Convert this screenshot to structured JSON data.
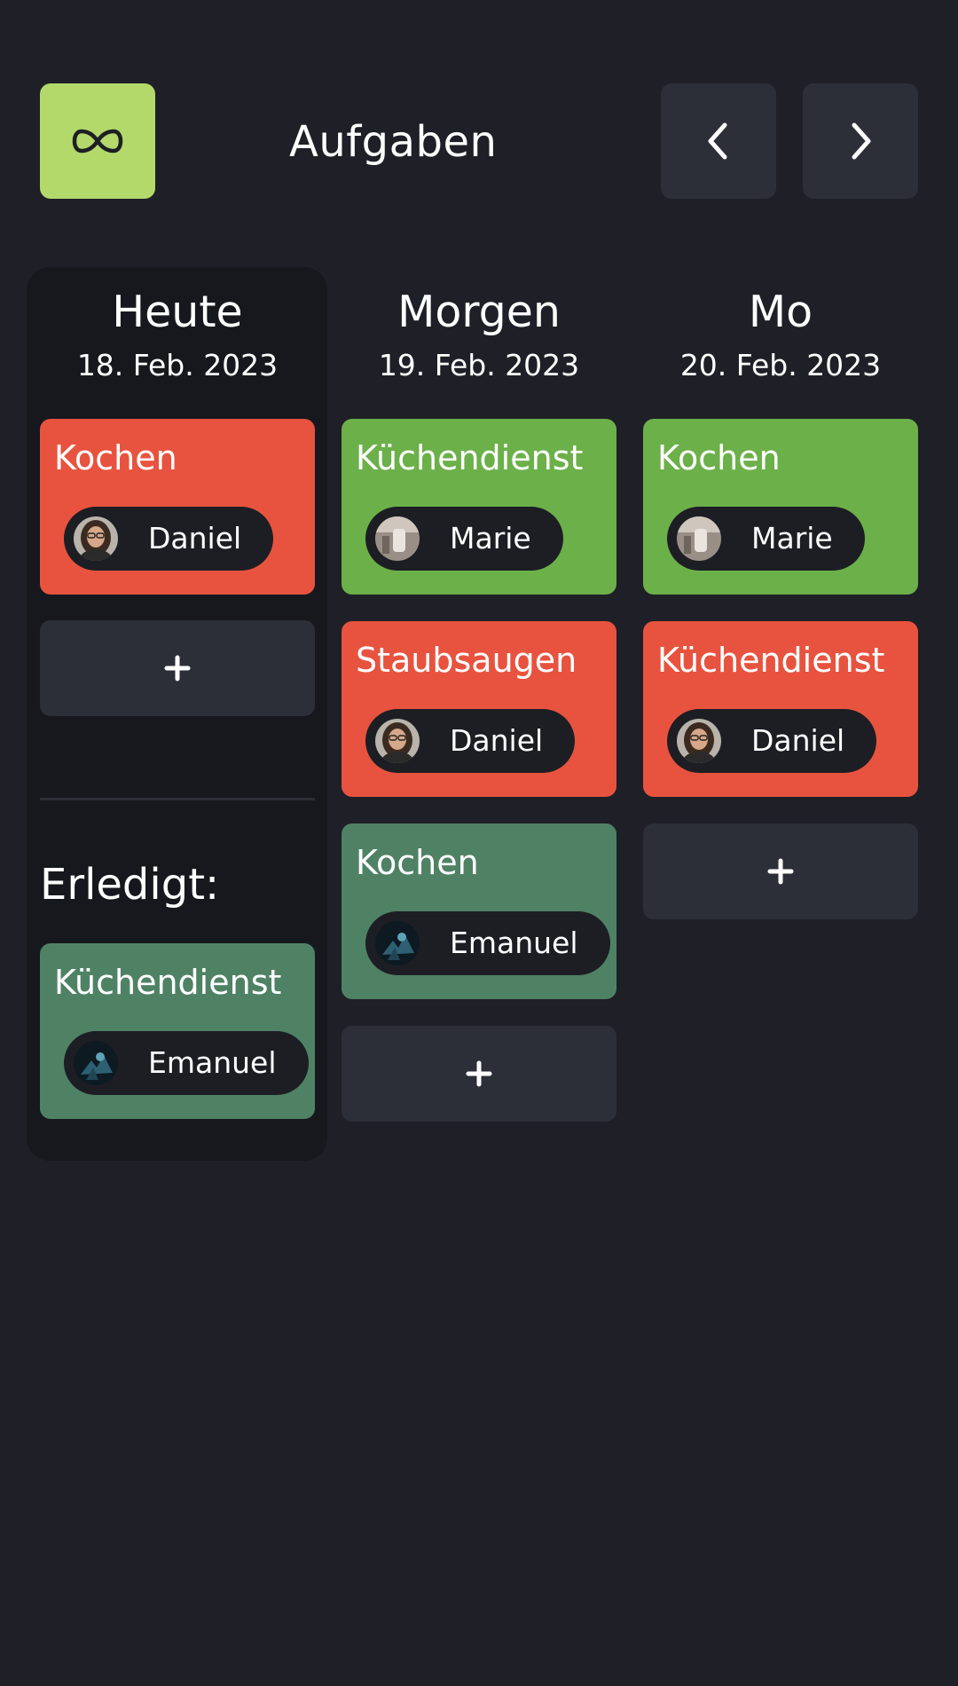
{
  "header": {
    "logo_icon": "infinity-icon",
    "title": "Aufgaben",
    "prev_icon": "chevron-left-icon",
    "next_icon": "chevron-right-icon",
    "accent_color": "#b3d96a"
  },
  "days": [
    {
      "name": "Heute",
      "date": "18. Feb. 2023",
      "tasks": [
        {
          "title": "Kochen",
          "assignee": "Daniel",
          "color": "#e8533f"
        }
      ],
      "add_label": "+",
      "done_heading": "Erledigt:",
      "done_tasks": [
        {
          "title": "Küchendienst",
          "assignee": "Emanuel",
          "color": "#4f8265"
        }
      ]
    },
    {
      "name": "Morgen",
      "date": "19. Feb. 2023",
      "tasks": [
        {
          "title": "Küchendienst",
          "assignee": "Marie",
          "color": "#6cb04a"
        },
        {
          "title": "Staubsaugen",
          "assignee": "Daniel",
          "color": "#e8533f"
        },
        {
          "title": "Kochen",
          "assignee": "Emanuel",
          "color": "#4f8265"
        }
      ],
      "add_label": "+"
    },
    {
      "name": "Mo",
      "date": "20. Feb. 2023",
      "tasks": [
        {
          "title": "Kochen",
          "assignee": "Marie",
          "color": "#6cb04a"
        },
        {
          "title": "Küchendienst",
          "assignee": "Daniel",
          "color": "#e8533f"
        }
      ],
      "add_label": "+"
    }
  ]
}
